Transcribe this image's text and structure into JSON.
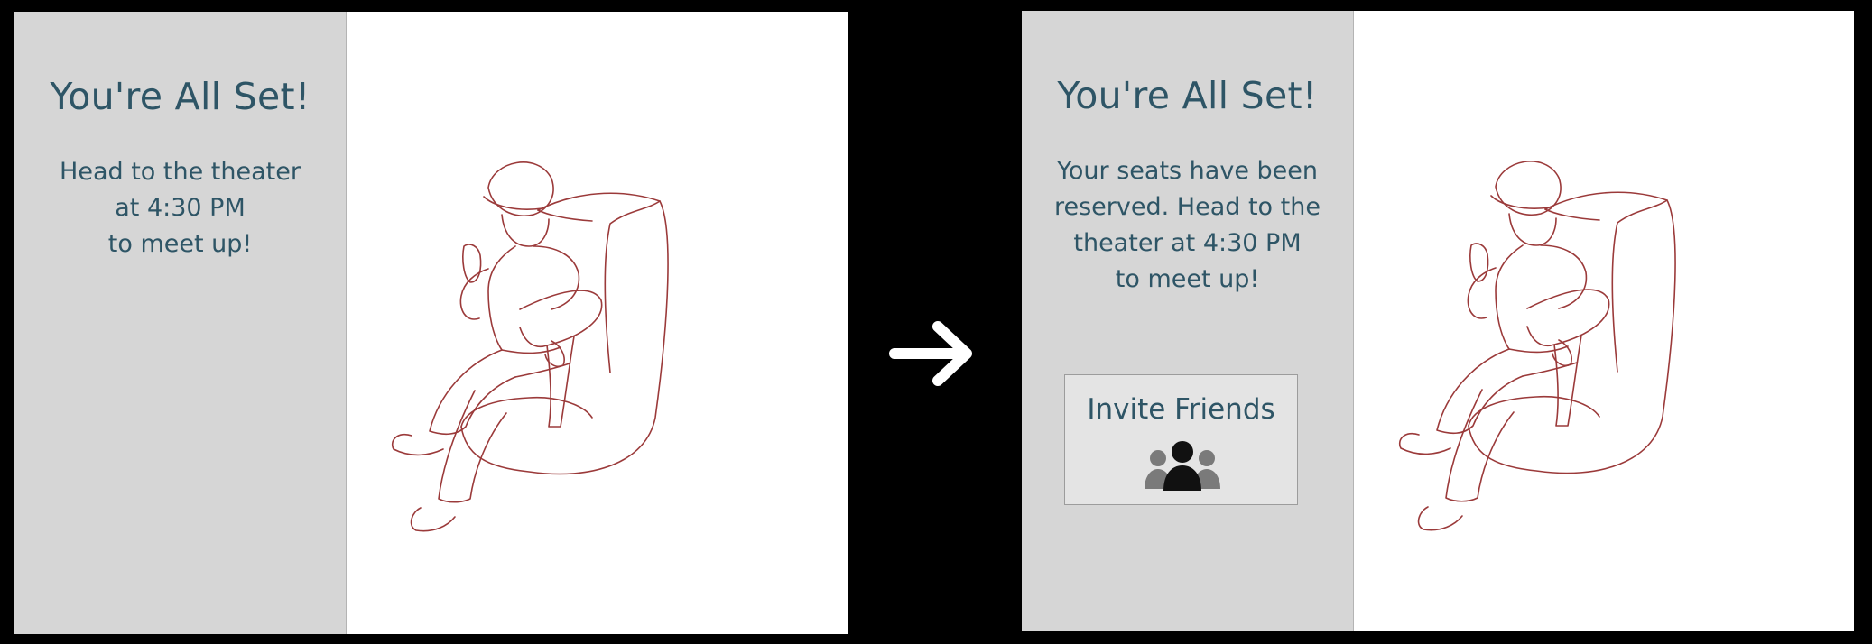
{
  "before": {
    "title": "You're All Set!",
    "message_lines": [
      "Head to the theater",
      "at 4:30 PM",
      "to meet up!"
    ]
  },
  "after": {
    "title": "You're All Set!",
    "message_lines": [
      "Your seats have been",
      "reserved. Head to the",
      "theater at 4:30 PM",
      "to meet up!"
    ],
    "invite_button": {
      "label": "Invite Friends",
      "icon": "group-people-icon"
    }
  },
  "transition_icon": "right-arrow-icon",
  "colors": {
    "panel_bg": "#d6d6d6",
    "text": "#2e5566",
    "sketch_stroke": "#9b3a3a",
    "backdrop": "#000000"
  }
}
